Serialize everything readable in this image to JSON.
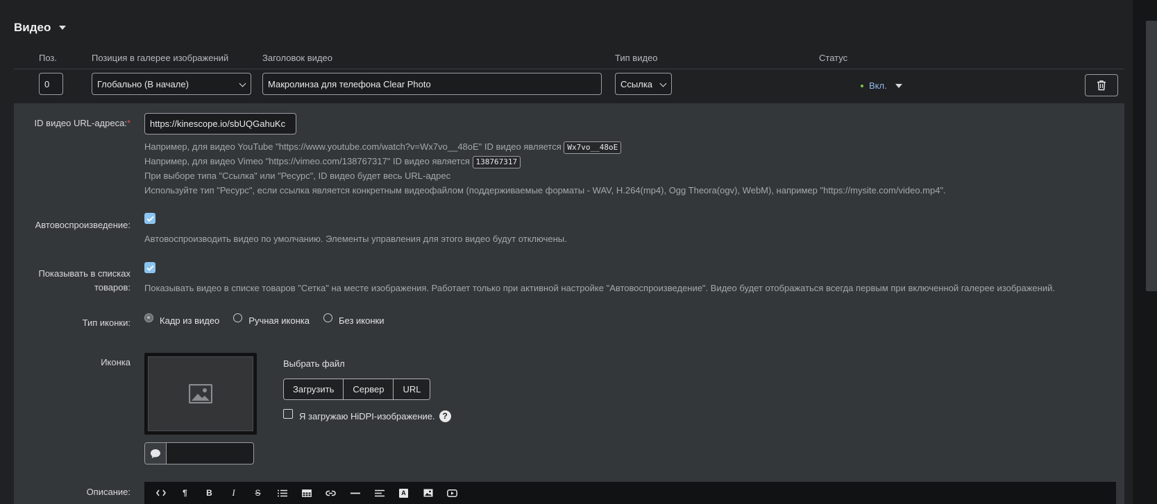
{
  "section": {
    "title": "Видео"
  },
  "columns": {
    "pos": "Поз.",
    "gallery_position": "Позиция в галерее изображений",
    "video_title": "Заголовок видео",
    "video_type": "Тип видео",
    "status": "Статус"
  },
  "row": {
    "pos_value": "0",
    "gallery_position_value": "Глобально (В начале)",
    "title_value": "Макролинза для телефона Clear Photo",
    "type_value": "Ссылка",
    "status_value": "Вкл."
  },
  "video_id": {
    "label": "ID видео URL-адреса:",
    "required_mark": "*",
    "value": "https://kinescope.io/sbUQGahuKc",
    "help1_text": "Например, для видео YouTube \"https://www.youtube.com/watch?v=Wx7vo__48oE\" ID видео является",
    "help1_code": "Wx7vo__48oE",
    "help2_text": "Например, для видео Vimeo \"https://vimeo.com/138767317\" ID видео является",
    "help2_code": "138767317",
    "help3": "При выборе типа \"Ссылка\" или \"Ресурс\", ID видео будет весь URL-адрес",
    "help4": "Используйте тип \"Ресурс\", если ссылка является конкретным видеофайлом (поддерживаемые форматы - WAV, H.264(mp4), Ogg Theora(ogv), WebM), например \"https://mysite.com/video.mp4\"."
  },
  "autoplay": {
    "label": "Автовоспроизведение:",
    "checked": true,
    "help": "Автовоспроизводить видео по умолчанию. Элементы управления для этого видео будут отключены."
  },
  "show_in_lists": {
    "label_line1": "Показывать в списках",
    "label_line2": "товаров:",
    "checked": true,
    "help": "Показывать видео в списке товаров \"Сетка\" на месте изображения. Работает только при активной настройке \"Автовоспроизведение\". Видео будет отображаться всегда первым при включенной галерее изображений."
  },
  "icon_type": {
    "label": "Тип иконки:",
    "options": [
      "Кадр из видео",
      "Ручная иконка",
      "Без иконки"
    ],
    "selected": "Кадр из видео"
  },
  "icon": {
    "label": "Иконка",
    "choose_file": "Выбрать файл",
    "buttons": [
      "Загрузить",
      "Сервер",
      "URL"
    ],
    "hidpi_label": "Я загружаю HiDPI-изображение.",
    "help_mark": "?"
  },
  "description": {
    "label": "Описание:",
    "toolbar": [
      "code-icon",
      "paragraph-icon",
      "bold-icon",
      "italic-icon",
      "strikethrough-icon",
      "list-icon",
      "table-icon",
      "link-icon",
      "horizontal-rule-icon",
      "align-icon",
      "text-color-icon",
      "image-icon",
      "video-icon"
    ],
    "bold_glyph": "B",
    "italic_glyph": "I",
    "strike_glyph": "S",
    "para_glyph": "¶",
    "text_color_glyph": "A"
  },
  "colors": {
    "panel": "#343739",
    "background": "#1f2123",
    "status_link": "#8fb8e8",
    "status_dot": "#7ac943",
    "checkbox": "#8cc4f0",
    "required": "#e05252"
  }
}
